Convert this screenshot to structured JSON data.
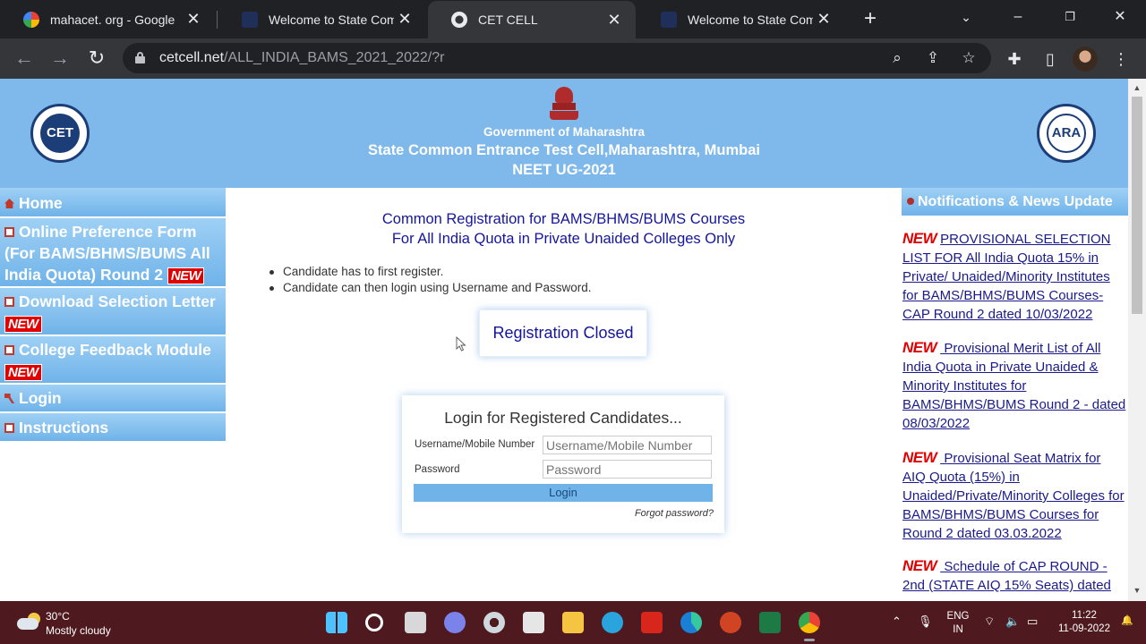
{
  "browser": {
    "tabs": [
      {
        "title": "mahacet. org - Google",
        "favicon": "google-icon",
        "active": false
      },
      {
        "title": "Welcome to State Com",
        "favicon": "site-icon",
        "active": false
      },
      {
        "title": "CET CELL",
        "favicon": "globe-icon",
        "active": true
      },
      {
        "title": "Welcome to State Com",
        "favicon": "site-icon",
        "active": false
      }
    ],
    "close_glyph": "✕",
    "new_tab_glyph": "+",
    "url_host": "cetcell.net",
    "url_path": "/ALL_INDIA_BAMS_2021_2022/?r"
  },
  "header": {
    "line1": "Government of Maharashtra",
    "line2": "State Common Entrance Test Cell,Maharashtra, Mumbai",
    "line3": "NEET UG-2021",
    "left_logo_text": "CET",
    "right_logo_text": "ARA"
  },
  "sidebar": {
    "items": [
      {
        "label": "Home",
        "icon": "home-icon",
        "new": false
      },
      {
        "label": "Online Preference Form (For BAMS/BHMS/BUMS All India Quota) Round 2",
        "icon": "edit-icon",
        "new": true
      },
      {
        "label": "Download Selection Letter",
        "icon": "edit-icon",
        "new": true
      },
      {
        "label": "College Feedback Module",
        "icon": "edit-icon",
        "new": true
      },
      {
        "label": "Login",
        "icon": "key-icon",
        "new": false
      },
      {
        "label": "Instructions",
        "icon": "edit-icon",
        "new": false
      }
    ],
    "new_label": "NEW"
  },
  "main": {
    "title1": "Common Registration for BAMS/BHMS/BUMS Courses",
    "title2": "For All India Quota in Private Unaided Colleges Only",
    "bullets": [
      "Candidate has to first register.",
      "Candidate can then login using Username and Password."
    ],
    "registration_status": "Registration Closed",
    "login": {
      "heading": "Login for Registered Candidates...",
      "username_label": "Username/Mobile Number",
      "username_placeholder": "Username/Mobile Number",
      "password_label": "Password",
      "password_placeholder": "Password",
      "button": "Login",
      "forgot": "Forgot password?"
    }
  },
  "news": {
    "heading": "Notifications & News Update",
    "new_label": "NEW",
    "items": [
      {
        "text": "PROVISIONAL SELECTION LIST FOR All India Quota 15% in Private/ Unaided/Minority Institutes for BAMS/BHMS/BUMS Courses- CAP Round 2 dated 10/03/2022"
      },
      {
        "text": " Provisional Merit List of All India Quota in Private Unaided & Minority Institutes for BAMS/BHMS/BUMS Round 2 - dated 08/03/2022"
      },
      {
        "text": " Provisional Seat Matrix for AIQ Quota (15%) in Unaided/Private/Minority Colleges for BAMS/BHMS/BUMS Courses for Round 2 dated 03.03.2022"
      },
      {
        "text": " Schedule of CAP ROUND - 2nd (STATE AIQ 15% Seats) dated"
      }
    ]
  },
  "taskbar": {
    "temperature": "30°C",
    "weather": "Mostly cloudy",
    "language_line1": "ENG",
    "language_line2": "IN",
    "time": "11:22",
    "date": "11-09-2022",
    "apps": [
      "windows-start-icon",
      "search-icon",
      "task-view-icon",
      "teams-icon",
      "app-icon",
      "inkscape-icon",
      "file-explorer-icon",
      "telegram-icon",
      "acrobat-icon",
      "edge-icon",
      "powerpoint-icon",
      "excel-icon",
      "chrome-icon"
    ]
  }
}
